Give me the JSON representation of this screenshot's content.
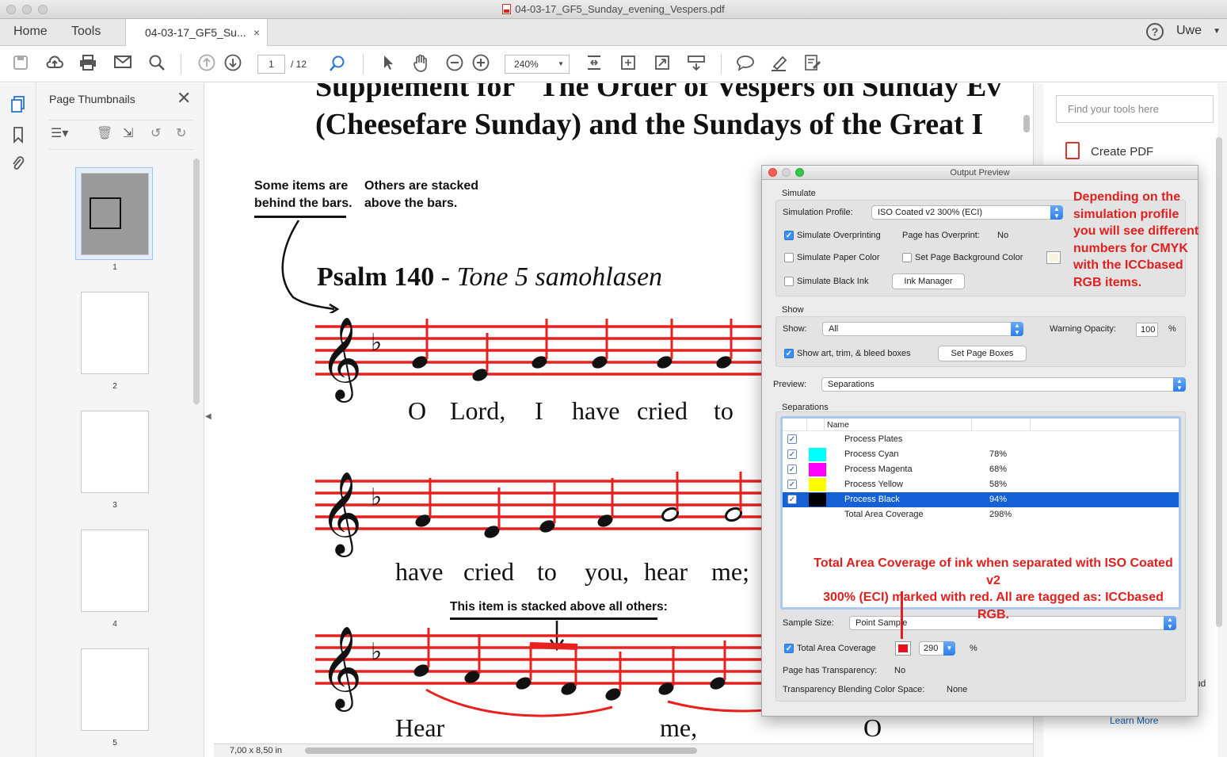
{
  "window": {
    "title": "04-03-17_GF5_Sunday_evening_Vespers.pdf"
  },
  "tabs": {
    "home": "Home",
    "tools": "Tools",
    "doc": "04-03-17_GF5_Su...",
    "close": "×",
    "help": "?",
    "user": "Uwe"
  },
  "toolbar": {
    "page_current": "1",
    "page_total": "/ 12",
    "zoom": "240%"
  },
  "thumbnails": {
    "title": "Page Thumbnails",
    "pages": [
      "1",
      "2",
      "3",
      "4",
      "5"
    ]
  },
  "document": {
    "title_line1": "Supplement for \"The Order of Vespers on Sunday Ev",
    "title_line2": "(Cheesefare Sunday) and the Sundays of the Great I",
    "annot_behind_1": "Some items are",
    "annot_behind_2": "behind the bars.",
    "annot_above_1": "Others are stacked",
    "annot_above_2": "above the bars.",
    "psalm_bold": "Psalm 140",
    "psalm_dash": " - ",
    "psalm_italic": "Tone 5 samohlasen",
    "lyric1": [
      "O",
      "Lord,",
      "I",
      "have",
      "cried",
      "to"
    ],
    "lyric2": [
      "have",
      "cried",
      "to",
      "you,",
      "hear",
      "me;"
    ],
    "annot_top": "This item is stacked above all others:",
    "lyric3": [
      "Hear",
      "me,",
      "O"
    ],
    "page_size": "7,00 x 8,50 in"
  },
  "right_pane": {
    "search_placeholder": "Find your tools here",
    "create_pdf": "Create PDF",
    "learn_more": "Learn More",
    "partial": "ud"
  },
  "output_preview": {
    "title": "Output Preview",
    "simulate_heading": "Simulate",
    "simulation_profile_label": "Simulation Profile:",
    "simulation_profile": "ISO Coated v2 300% (ECI)",
    "simulate_overprinting": "Simulate Overprinting",
    "page_has_overprint_label": "Page has Overprint:",
    "page_has_overprint": "No",
    "simulate_paper_color": "Simulate Paper Color",
    "set_page_bg": "Set Page Background Color",
    "simulate_black_ink": "Simulate Black Ink",
    "ink_manager": "Ink Manager",
    "show_heading": "Show",
    "show_label": "Show:",
    "show_value": "All",
    "warning_opacity_label": "Warning Opacity:",
    "warning_opacity": "100",
    "percent": "%",
    "show_boxes": "Show art, trim, & bleed boxes",
    "set_page_boxes": "Set Page Boxes",
    "preview_label": "Preview:",
    "preview_value": "Separations",
    "separations_heading": "Separations",
    "col_name": "Name",
    "separations": [
      {
        "name": "Process Plates",
        "pct": "",
        "color": ""
      },
      {
        "name": "Process Cyan",
        "pct": "78%",
        "color": "#00ffff"
      },
      {
        "name": "Process Magenta",
        "pct": "68%",
        "color": "#ff00ff"
      },
      {
        "name": "Process Yellow",
        "pct": "58%",
        "color": "#ffff00"
      },
      {
        "name": "Process Black",
        "pct": "94%",
        "color": "#000000"
      },
      {
        "name": "Total Area Coverage",
        "pct": "298%",
        "color": ""
      }
    ],
    "sample_size_label": "Sample Size:",
    "sample_size": "Point Sample",
    "total_area_coverage": "Total Area Coverage",
    "tac_value": "290",
    "page_has_transparency_label": "Page has Transparency:",
    "page_has_transparency": "No",
    "tbcs_label": "Transparency Blending Color Space:",
    "tbcs": "None"
  },
  "annotations": {
    "profile_note": [
      "Depending on the",
      "simulation profile",
      "you will see different",
      "numbers for CMYK",
      "with the ICCbased",
      "RGB items."
    ],
    "tac_note": [
      "Total Area Coverage of ink when separated with ISO Coated v2",
      "300% (ECI) marked with red. All are tagged as: ICCbased RGB."
    ]
  },
  "colors": {
    "accent": "#e0201e",
    "selection": "#1560d4",
    "staff": "#e8201e"
  }
}
